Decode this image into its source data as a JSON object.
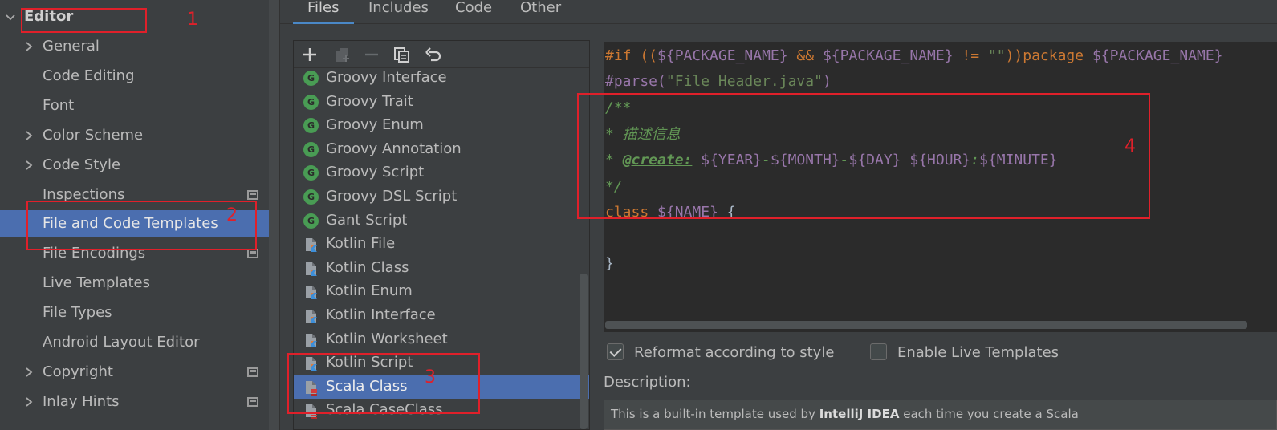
{
  "sidebar": {
    "root_label": "Editor",
    "items": [
      {
        "label": "General",
        "expandable": true,
        "scope_marker": false
      },
      {
        "label": "Code Editing",
        "expandable": false,
        "scope_marker": false
      },
      {
        "label": "Font",
        "expandable": false,
        "scope_marker": false
      },
      {
        "label": "Color Scheme",
        "expandable": true,
        "scope_marker": false
      },
      {
        "label": "Code Style",
        "expandable": true,
        "scope_marker": false
      },
      {
        "label": "Inspections",
        "expandable": false,
        "scope_marker": true
      },
      {
        "label": "File and Code Templates",
        "expandable": false,
        "scope_marker": false,
        "selected": true
      },
      {
        "label": "File Encodings",
        "expandable": false,
        "scope_marker": true
      },
      {
        "label": "Live Templates",
        "expandable": false,
        "scope_marker": false
      },
      {
        "label": "File Types",
        "expandable": false,
        "scope_marker": false
      },
      {
        "label": "Android Layout Editor",
        "expandable": false,
        "scope_marker": false
      },
      {
        "label": "Copyright",
        "expandable": true,
        "scope_marker": true
      },
      {
        "label": "Inlay Hints",
        "expandable": true,
        "scope_marker": true
      }
    ]
  },
  "tabs": {
    "items": [
      {
        "label": "Files",
        "active": true
      },
      {
        "label": "Includes",
        "active": false
      },
      {
        "label": "Code",
        "active": false
      },
      {
        "label": "Other",
        "active": false
      }
    ]
  },
  "toolbar": {
    "add_icon": "plus-icon",
    "copy_icon": "copy-icon",
    "remove_icon": "minus-icon",
    "duplicate_icon": "duplicate-icon",
    "reset_icon": "undo-icon"
  },
  "templates": {
    "items": [
      {
        "label": "Groovy Interface",
        "icon": "groovy"
      },
      {
        "label": "Groovy Trait",
        "icon": "groovy"
      },
      {
        "label": "Groovy Enum",
        "icon": "groovy"
      },
      {
        "label": "Groovy Annotation",
        "icon": "groovy"
      },
      {
        "label": "Groovy Script",
        "icon": "groovy"
      },
      {
        "label": "Groovy DSL Script",
        "icon": "groovy"
      },
      {
        "label": "Gant Script",
        "icon": "groovy"
      },
      {
        "label": "Kotlin File",
        "icon": "kotlin"
      },
      {
        "label": "Kotlin Class",
        "icon": "kotlin"
      },
      {
        "label": "Kotlin Enum",
        "icon": "kotlin"
      },
      {
        "label": "Kotlin Interface",
        "icon": "kotlin"
      },
      {
        "label": "Kotlin Worksheet",
        "icon": "kotlin"
      },
      {
        "label": "Kotlin Script",
        "icon": "kotlin"
      },
      {
        "label": "Scala Class",
        "icon": "scala",
        "selected": true
      },
      {
        "label": "Scala CaseClass",
        "icon": "scala"
      }
    ],
    "groovy_letter": "G"
  },
  "editor": {
    "line1": {
      "a": "#if ((",
      "b": "${PACKAGE_NAME}",
      "c": " && ",
      "d": "${PACKAGE_NAME}",
      "e": " != ",
      "f": "\"\"",
      "g": "))",
      "h": "package ",
      "i": "${PACKAGE_NAME}"
    },
    "line2": {
      "a": "#parse(",
      "b": "\"File Header.java\"",
      "c": ")"
    },
    "line3": "/**",
    "line4": "* 描述信息",
    "line5": {
      "a": "* ",
      "b": "@create:",
      "c": " ",
      "d": "${YEAR}",
      "e": "-",
      "f": "${MONTH}",
      "g": "-",
      "h": "${DAY}",
      "i": " ",
      "j": "${HOUR}",
      "k": ":",
      "l": "${MINUTE}"
    },
    "line6": "*/",
    "line7": {
      "a": "class ",
      "b": "${NAME}",
      "c": " {"
    },
    "line9": "}"
  },
  "options": {
    "reformat_label": "Reformat according to style",
    "reformat_checked": true,
    "live_templates_label": "Enable Live Templates",
    "live_templates_checked": false
  },
  "description": {
    "label": "Description:",
    "text_before": "This is a built-in template used by ",
    "text_bold": "IntelliJ IDEA",
    "text_after": " each time you create a Scala"
  },
  "annotations": {
    "n1": "1",
    "n2": "2",
    "n3": "3",
    "n4": "4",
    "color": "#e0202a"
  },
  "colors": {
    "selection": "#4b6eaf",
    "background": "#3c3f41",
    "editor_bg": "#2b2b2b"
  }
}
